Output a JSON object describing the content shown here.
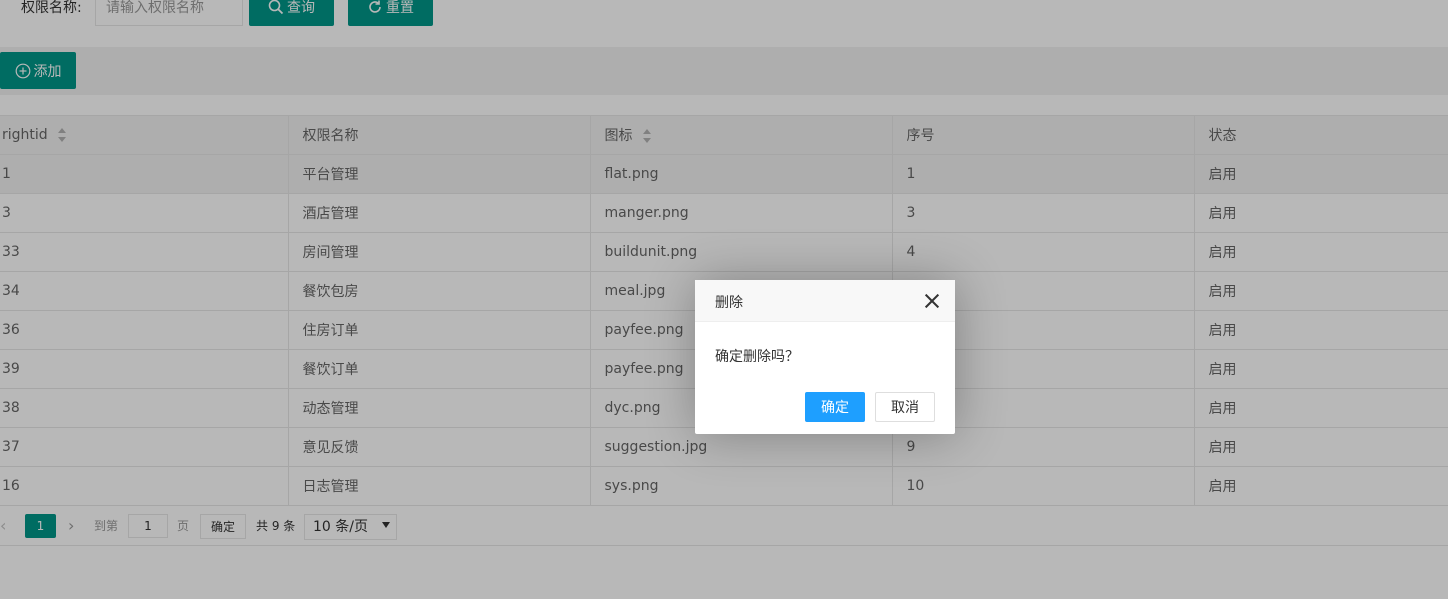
{
  "search": {
    "label": "权限名称:",
    "placeholder": "请输入权限名称",
    "search_button": "查询",
    "reset_button": "重置"
  },
  "toolbar": {
    "add_button": "添加"
  },
  "table": {
    "columns": [
      "rightid",
      "权限名称",
      "图标",
      "序号",
      "状态"
    ],
    "rows": [
      [
        "1",
        "平台管理",
        "flat.png",
        "1",
        "启用"
      ],
      [
        "3",
        "酒店管理",
        "manger.png",
        "3",
        "启用"
      ],
      [
        "33",
        "房间管理",
        "buildunit.png",
        "4",
        "启用"
      ],
      [
        "34",
        "餐饮包房",
        "meal.jpg",
        "",
        "启用"
      ],
      [
        "36",
        "住房订单",
        "payfee.png",
        "",
        "启用"
      ],
      [
        "39",
        "餐饮订单",
        "payfee.png",
        "",
        "启用"
      ],
      [
        "38",
        "动态管理",
        "dyc.png",
        "",
        "启用"
      ],
      [
        "37",
        "意见反馈",
        "suggestion.jpg",
        "9",
        "启用"
      ],
      [
        "16",
        "日志管理",
        "sys.png",
        "10",
        "启用"
      ]
    ]
  },
  "pagination": {
    "prev": "‹",
    "current": "1",
    "next": "›",
    "goto_label": "到第",
    "goto_value": "1",
    "page_suffix": "页",
    "confirm": "确定",
    "total": "共 9 条",
    "page_size": "10 条/页"
  },
  "dialog": {
    "title": "删除",
    "message": "确定删除吗？",
    "ok": "确定",
    "cancel": "取消"
  },
  "colors": {
    "primary": "#009688",
    "dialog_ok": "#1e9fff"
  }
}
